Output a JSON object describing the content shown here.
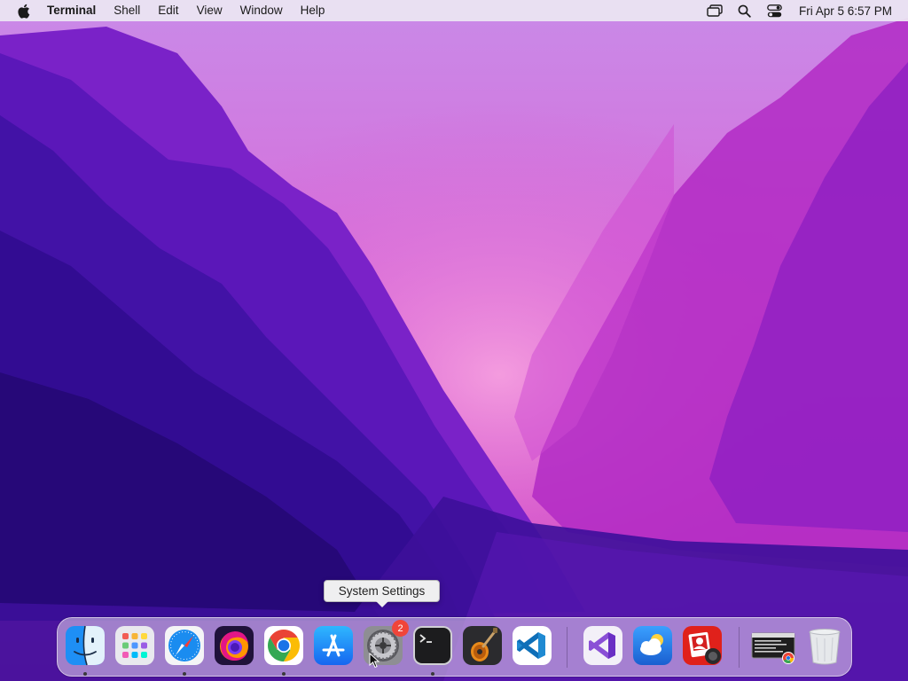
{
  "menubar": {
    "app_name": "Terminal",
    "items": [
      "Shell",
      "Edit",
      "View",
      "Window",
      "Help"
    ],
    "status_icons": [
      "screen-mirroring-icon",
      "spotlight-search-icon",
      "control-center-icon"
    ],
    "clock": "Fri Apr 5  6:57 PM"
  },
  "tooltip": {
    "text": "System Settings"
  },
  "dock": {
    "apps": [
      {
        "name": "Finder",
        "icon": "finder-icon",
        "running": true
      },
      {
        "name": "Launchpad",
        "icon": "launchpad-icon",
        "running": false
      },
      {
        "name": "Safari",
        "icon": "safari-icon",
        "running": true
      },
      {
        "name": "Firefox",
        "icon": "firefox-icon",
        "running": false
      },
      {
        "name": "Google Chrome",
        "icon": "chrome-icon",
        "running": true
      },
      {
        "name": "App Store",
        "icon": "app-store-icon",
        "running": false
      },
      {
        "name": "System Settings",
        "icon": "system-settings-icon",
        "running": false,
        "badge": "2"
      },
      {
        "name": "Terminal",
        "icon": "terminal-icon",
        "running": true
      },
      {
        "name": "GarageBand",
        "icon": "garageband-icon",
        "running": false
      },
      {
        "name": "Visual Studio Code",
        "icon": "vscode-icon",
        "running": false
      }
    ],
    "recent_apps": [
      {
        "name": "Visual Studio",
        "icon": "visual-studio-icon"
      },
      {
        "name": "Weather",
        "icon": "weather-icon"
      },
      {
        "name": "Photo Booth",
        "icon": "photo-booth-icon"
      }
    ],
    "minimized": [
      {
        "name": "Chrome window",
        "icon": "chrome-window-thumbnail-icon"
      },
      {
        "name": "Trash",
        "icon": "trash-icon"
      }
    ]
  },
  "colors": {
    "wallpaper_deep": "#2a0a6e",
    "wallpaper_purple": "#7a1fc4",
    "wallpaper_pink": "#d24fc8",
    "menubar_bg": "#ece6f2",
    "badge": "#f0453a"
  }
}
